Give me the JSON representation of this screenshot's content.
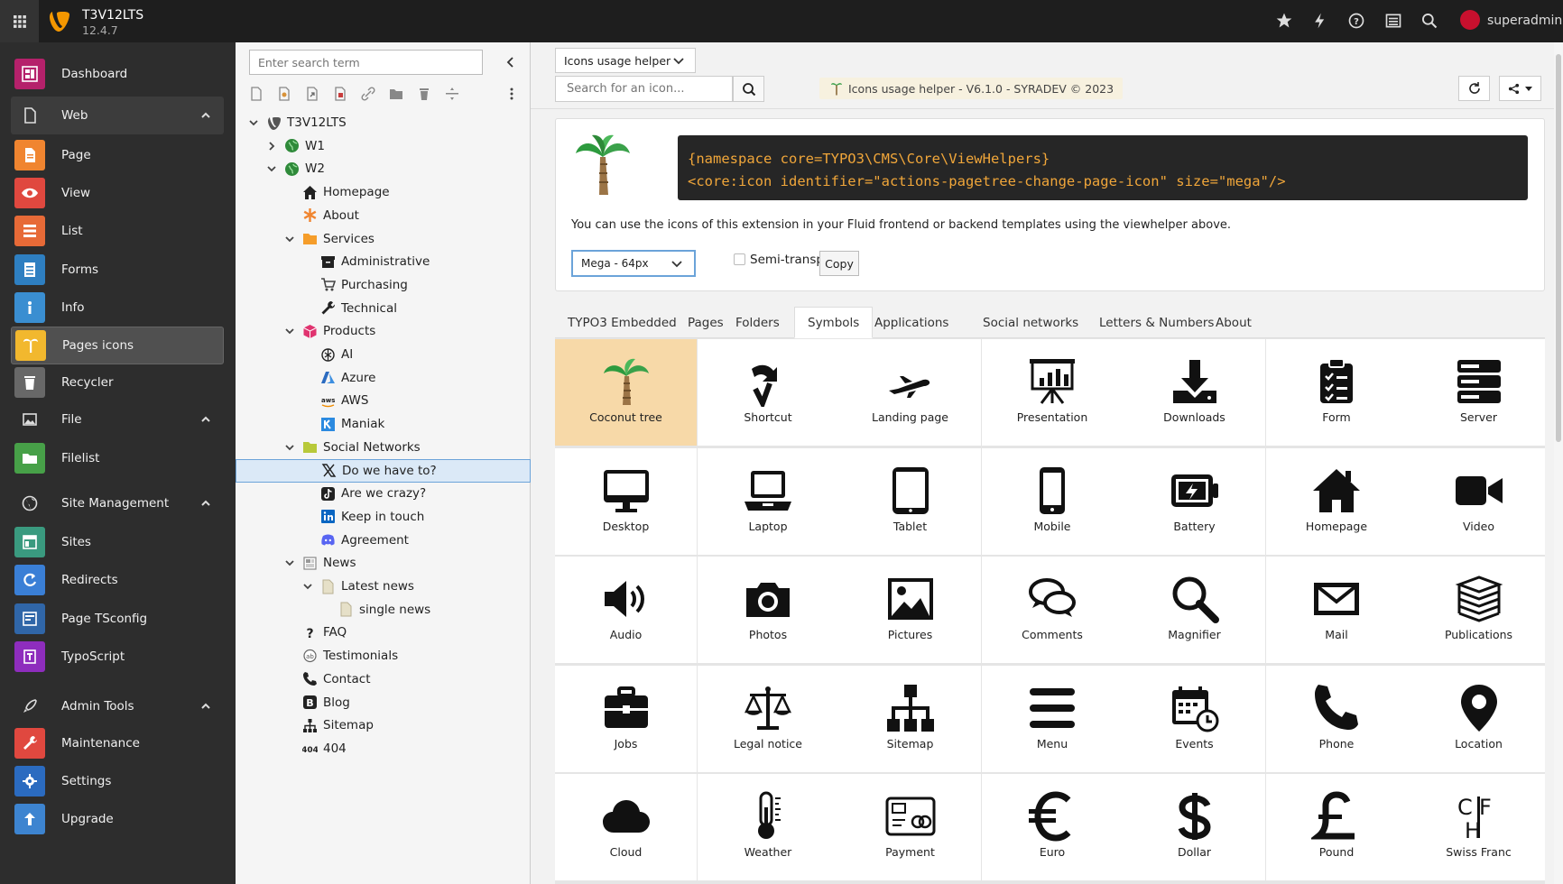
{
  "topbar": {
    "site_name": "T3V12LTS",
    "version": "12.4.7",
    "username": "superadmin",
    "icons": [
      "apps-grid-icon",
      "typo3-logo-icon",
      "star-icon",
      "bolt-icon",
      "help-icon",
      "list-icon",
      "search-icon",
      "user-avatar-icon"
    ]
  },
  "sidebar": {
    "items": [
      {
        "label": "Dashboard",
        "icon": "dashboard-icon",
        "color": "#b5216b"
      },
      {
        "label": "Web",
        "icon": "page-icon",
        "section": true
      },
      {
        "label": "Page",
        "icon": "page-icon",
        "color": "#f08530"
      },
      {
        "label": "View",
        "icon": "eye-icon",
        "color": "#e0483f"
      },
      {
        "label": "List",
        "icon": "list-icon",
        "color": "#e76a37"
      },
      {
        "label": "Forms",
        "icon": "form-icon",
        "color": "#2e7fc1"
      },
      {
        "label": "Info",
        "icon": "info-icon",
        "color": "#3a8ed1"
      },
      {
        "label": "Pages icons",
        "icon": "palm-icon",
        "color": "#f2b82e"
      },
      {
        "label": "Recycler",
        "icon": "trash-icon",
        "color": "#686868"
      },
      {
        "label": "File",
        "icon": "image-icon",
        "section": true
      },
      {
        "label": "Filelist",
        "icon": "folder-cloud-icon",
        "color": "#47a048"
      },
      {
        "label": "Site Management",
        "icon": "globe-icon",
        "section": true
      },
      {
        "label": "Sites",
        "icon": "site-icon",
        "color": "#3a9a7f"
      },
      {
        "label": "Redirects",
        "icon": "redirect-icon",
        "color": "#3a7fd6"
      },
      {
        "label": "Page TSconfig",
        "icon": "tsconfig-icon",
        "color": "#3066a8"
      },
      {
        "label": "TypoScript",
        "icon": "typoscript-icon",
        "color": "#8e2dbd"
      },
      {
        "label": "Admin Tools",
        "icon": "rocket-icon",
        "section": true
      },
      {
        "label": "Maintenance",
        "icon": "wrench-icon",
        "color": "#e0483f"
      },
      {
        "label": "Settings",
        "icon": "gear-icon",
        "color": "#2b6bc0"
      },
      {
        "label": "Upgrade",
        "icon": "upgrade-icon",
        "color": "#3d84d0"
      }
    ]
  },
  "tree": {
    "search_placeholder": "Enter search term",
    "nodes": [
      {
        "label": "T3V12LTS",
        "level": 0,
        "toggle": "open",
        "icon": "typo3-site-icon"
      },
      {
        "label": "W1",
        "level": 1,
        "toggle": "closed",
        "icon": "globe-green-icon"
      },
      {
        "label": "W2",
        "level": 1,
        "toggle": "open",
        "icon": "globe-green-icon"
      },
      {
        "label": "Homepage",
        "level": 2,
        "icon": "home-icon"
      },
      {
        "label": "About",
        "level": 2,
        "icon": "asterisk-icon"
      },
      {
        "label": "Services",
        "level": 2,
        "toggle": "open",
        "icon": "folder-orange-icon"
      },
      {
        "label": "Administrative",
        "level": 3,
        "icon": "archive-icon"
      },
      {
        "label": "Purchasing",
        "level": 3,
        "icon": "cart-icon"
      },
      {
        "label": "Technical",
        "level": 3,
        "icon": "wrench-icon"
      },
      {
        "label": "Products",
        "level": 2,
        "toggle": "open",
        "icon": "cube-pink-icon"
      },
      {
        "label": "AI",
        "level": 3,
        "icon": "openai-icon"
      },
      {
        "label": "Azure",
        "level": 3,
        "icon": "azure-icon"
      },
      {
        "label": "AWS",
        "level": 3,
        "icon": "aws-icon"
      },
      {
        "label": "Maniak",
        "level": 3,
        "icon": "k-icon"
      },
      {
        "label": "Social Networks",
        "level": 2,
        "toggle": "open",
        "icon": "folder-yellowgreen-icon"
      },
      {
        "label": "Do we have to?",
        "level": 3,
        "icon": "x-icon",
        "selected": true
      },
      {
        "label": "Are we crazy?",
        "level": 3,
        "icon": "tiktok-icon"
      },
      {
        "label": "Keep in touch",
        "level": 3,
        "icon": "linkedin-icon"
      },
      {
        "label": "Agreement",
        "level": 3,
        "icon": "discord-icon"
      },
      {
        "label": "News",
        "level": 2,
        "toggle": "open",
        "icon": "news-icon"
      },
      {
        "label": "Latest news",
        "level": 3,
        "toggle": "open",
        "icon": "page-icon"
      },
      {
        "label": "single news",
        "level": 4,
        "icon": "page-icon"
      },
      {
        "label": "FAQ",
        "level": 2,
        "icon": "question-icon"
      },
      {
        "label": "Testimonials",
        "level": 2,
        "icon": "testimonial-icon"
      },
      {
        "label": "Contact",
        "level": 2,
        "icon": "phone-icon"
      },
      {
        "label": "Blog",
        "level": 2,
        "icon": "blog-icon"
      },
      {
        "label": "Sitemap",
        "level": 2,
        "icon": "sitemap-icon"
      },
      {
        "label": "404",
        "level": 2,
        "icon": "404-icon"
      }
    ]
  },
  "main": {
    "module_select": "Icons usage helper",
    "icon_search_placeholder": "Search for an icon...",
    "helper_badge": "Icons usage helper - V6.1.0 - SYRADEV © 2023",
    "code_line1": "{namespace core=TYPO3\\CMS\\Core\\ViewHelpers}",
    "code_line2": "<core:icon identifier=\"actions-pagetree-change-page-icon\" size=\"mega\"/>",
    "usage_text": "You can use the icons of this extension in your Fluid frontend or backend templates using the viewhelper above.",
    "size_select": "Mega - 64px",
    "semi_transparent_label": "Semi-transparent",
    "copy_label": "Copy",
    "tabs": [
      "TYPO3 Embedded",
      "Pages",
      "Folders",
      "Symbols",
      "Applications",
      "Social networks",
      "Letters & Numbers",
      "About"
    ],
    "active_tab": "Symbols",
    "icons": [
      {
        "label": "Coconut tree",
        "icon": "coconut-tree-icon",
        "selected": true
      },
      {
        "label": "Shortcut",
        "icon": "shortcut-icon"
      },
      {
        "label": "Landing page",
        "icon": "landing-page-icon"
      },
      {
        "label": "Presentation",
        "icon": "presentation-icon"
      },
      {
        "label": "Downloads",
        "icon": "downloads-icon"
      },
      {
        "label": "Form",
        "icon": "form-icon"
      },
      {
        "label": "Server",
        "icon": "server-icon"
      },
      {
        "label": "Desktop",
        "icon": "desktop-icon"
      },
      {
        "label": "Laptop",
        "icon": "laptop-icon"
      },
      {
        "label": "Tablet",
        "icon": "tablet-icon"
      },
      {
        "label": "Mobile",
        "icon": "mobile-icon"
      },
      {
        "label": "Battery",
        "icon": "battery-icon"
      },
      {
        "label": "Homepage",
        "icon": "homepage-icon"
      },
      {
        "label": "Video",
        "icon": "video-icon"
      },
      {
        "label": "Audio",
        "icon": "audio-icon"
      },
      {
        "label": "Photos",
        "icon": "photos-icon"
      },
      {
        "label": "Pictures",
        "icon": "pictures-icon"
      },
      {
        "label": "Comments",
        "icon": "comments-icon"
      },
      {
        "label": "Magnifier",
        "icon": "magnifier-icon"
      },
      {
        "label": "Mail",
        "icon": "mail-icon"
      },
      {
        "label": "Publications",
        "icon": "publications-icon"
      },
      {
        "label": "Jobs",
        "icon": "jobs-icon"
      },
      {
        "label": "Legal notice",
        "icon": "legal-notice-icon"
      },
      {
        "label": "Sitemap",
        "icon": "sitemap-icon"
      },
      {
        "label": "Menu",
        "icon": "menu-icon"
      },
      {
        "label": "Events",
        "icon": "events-icon"
      },
      {
        "label": "Phone",
        "icon": "phone-icon"
      },
      {
        "label": "Location",
        "icon": "location-icon"
      },
      {
        "label": "Cloud",
        "icon": "cloud-icon"
      },
      {
        "label": "Weather",
        "icon": "weather-icon"
      },
      {
        "label": "Payment",
        "icon": "payment-icon"
      },
      {
        "label": "Euro",
        "icon": "euro-icon"
      },
      {
        "label": "Dollar",
        "icon": "dollar-icon"
      },
      {
        "label": "Pound",
        "icon": "pound-icon"
      },
      {
        "label": "Swiss Franc",
        "icon": "swiss-franc-icon"
      }
    ]
  }
}
